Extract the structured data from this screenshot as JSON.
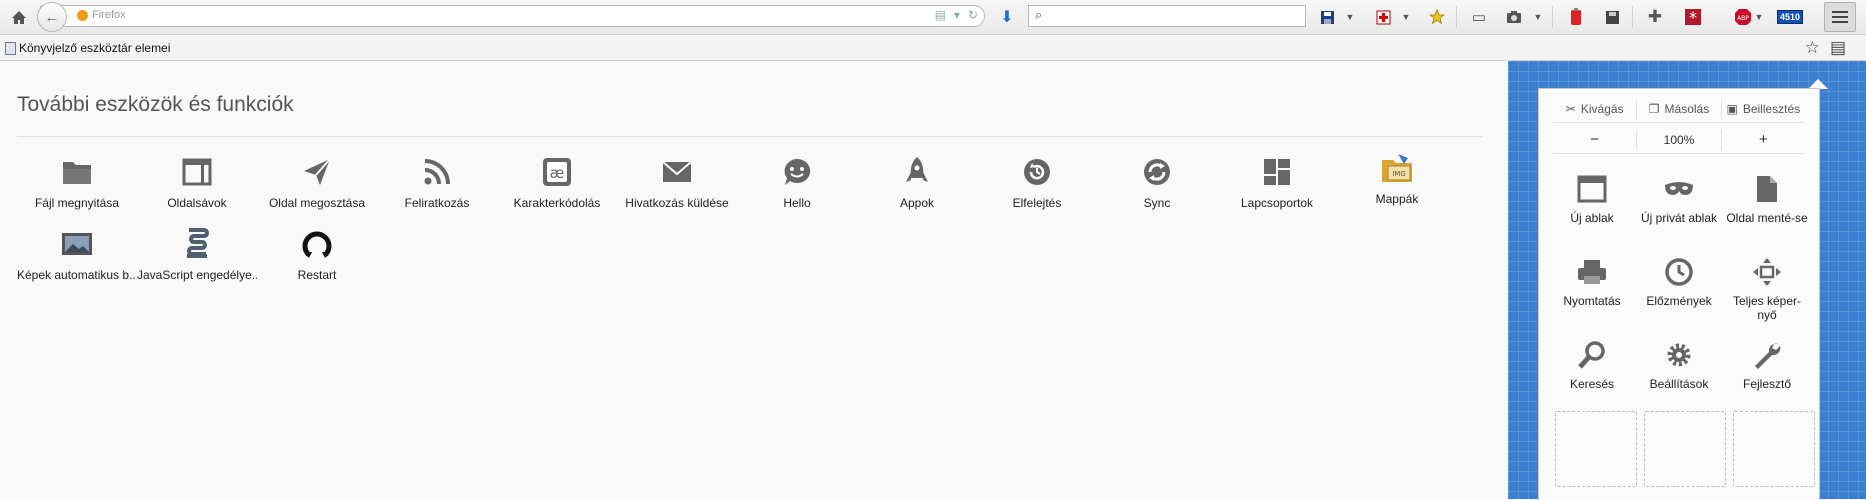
{
  "toolbar": {
    "url_title": "Firefox",
    "search_placeholder": "",
    "badge_count": "4510",
    "abp_label": "ABP"
  },
  "bookmarks": {
    "folder_label": "Könyvjelző eszköztár elemei"
  },
  "palette": {
    "title": "További eszközök és funkciók",
    "items": [
      {
        "label": "Fájl megnyitása",
        "icon": "folder-icon"
      },
      {
        "label": "Oldalsávok",
        "icon": "sidebar-icon"
      },
      {
        "label": "Oldal megosztása",
        "icon": "share-icon"
      },
      {
        "label": "Feliratkozás",
        "icon": "feed-icon"
      },
      {
        "label": "Karakterkódolás",
        "icon": "encoding-icon"
      },
      {
        "label": "Hivatkozás küldése",
        "icon": "email-icon"
      },
      {
        "label": "Hello",
        "icon": "hello-icon"
      },
      {
        "label": "Appok",
        "icon": "apps-icon"
      },
      {
        "label": "Elfelejtés",
        "icon": "forget-icon"
      },
      {
        "label": "Sync",
        "icon": "sync-icon"
      },
      {
        "label": "Lapcsoportok",
        "icon": "tab-groups-icon"
      },
      {
        "label": "Mappák",
        "icon": "folders-icon"
      },
      {
        "label": "Képek automatikus b...",
        "icon": "image-icon"
      },
      {
        "label": "JavaScript engedélye...",
        "icon": "javascript-icon"
      },
      {
        "label": "Restart",
        "icon": "restart-icon"
      }
    ]
  },
  "panel": {
    "edit": {
      "cut": "Kivágás",
      "copy": "Másolás",
      "paste": "Beillesztés"
    },
    "zoom": {
      "minus": "−",
      "value": "100%",
      "plus": "+"
    },
    "items": [
      {
        "label": "Új ablak",
        "icon": "new-window-icon"
      },
      {
        "label": "Új privát ablak",
        "icon": "private-window-icon"
      },
      {
        "label": "Oldal menté-se",
        "icon": "save-page-icon"
      },
      {
        "label": "Nyomtatás",
        "icon": "print-icon"
      },
      {
        "label": "Előzmények",
        "icon": "history-icon"
      },
      {
        "label": "Teljes képer-nyő",
        "icon": "fullscreen-icon"
      },
      {
        "label": "Keresés",
        "icon": "find-icon"
      },
      {
        "label": "Beállítások",
        "icon": "options-icon"
      },
      {
        "label": "Fejlesztő",
        "icon": "developer-icon"
      }
    ]
  }
}
